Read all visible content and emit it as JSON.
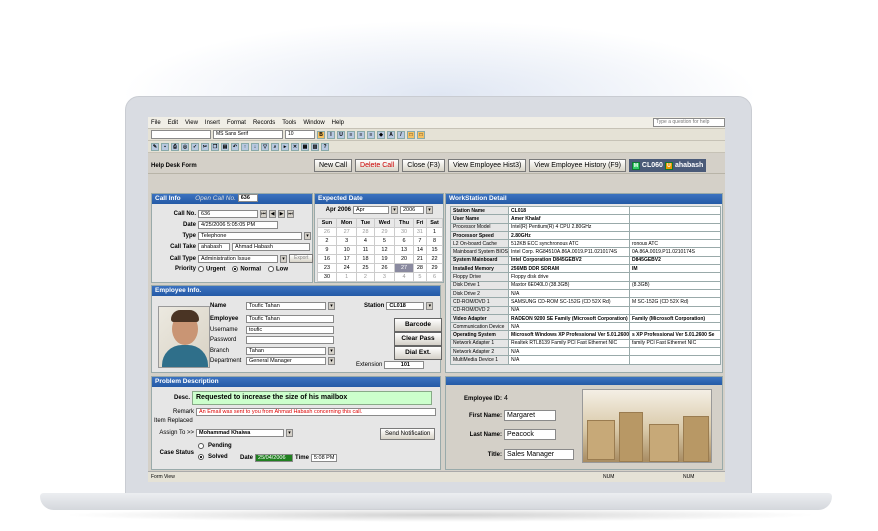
{
  "menu": [
    "File",
    "Edit",
    "View",
    "Insert",
    "Format",
    "Records",
    "Tools",
    "Window",
    "Help"
  ],
  "help_placeholder": "Type a question for help",
  "toolbar": {
    "font": "MS Sans Serif",
    "size": "10"
  },
  "form_title": "Help Desk Form",
  "buttons": {
    "new_call": "New Call",
    "delete_call": "Delete Call",
    "close": "Close (F3)",
    "view_hist": "View Employee Hist3)",
    "view_history": "View Employee History (F9)"
  },
  "emp_box": {
    "code": "CL060",
    "name": "ahabash"
  },
  "call_info": {
    "header": "Call Info",
    "open_call": "Open Call No.",
    "open_no": "636",
    "call_no_label": "Call No.",
    "call_no": "636",
    "date_label": "Date",
    "date": "4/25/2006 5:05:05 PM",
    "type_label": "Type",
    "type": "Telephone",
    "take_label": "Call Take",
    "take_user": "ahabash",
    "take_name": "Ahmad Habash",
    "calltype_label": "Call Type",
    "calltype": "Administration Issue",
    "export": "Export",
    "priority_label": "Priority",
    "priorities": [
      "Urgent",
      "Normal",
      "Low"
    ]
  },
  "expected": {
    "header": "Expected Date",
    "month_label": "Apr 2006",
    "month": "Apr",
    "year": "2006",
    "days": [
      "Sun",
      "Mon",
      "Tue",
      "Wed",
      "Thu",
      "Fri",
      "Sat"
    ],
    "weeks": [
      [
        "26",
        "27",
        "28",
        "29",
        "30",
        "31",
        "1"
      ],
      [
        "2",
        "3",
        "4",
        "5",
        "6",
        "7",
        "8"
      ],
      [
        "9",
        "10",
        "11",
        "12",
        "13",
        "14",
        "15"
      ],
      [
        "16",
        "17",
        "18",
        "19",
        "20",
        "21",
        "22"
      ],
      [
        "23",
        "24",
        "25",
        "26",
        "27",
        "28",
        "29"
      ],
      [
        "30",
        "1",
        "2",
        "3",
        "4",
        "5",
        "6"
      ]
    ]
  },
  "employee": {
    "header": "Employee Info.",
    "name_label": "Name",
    "name": "Toufic Tahan",
    "employee_label": "Employee",
    "employee": "Toufic Tahan",
    "username_label": "Username",
    "username": "toufic",
    "password_label": "Password",
    "branch_label": "Branch",
    "branch": "Tahan",
    "department_label": "Department",
    "department": "General Manager",
    "station_label": "Station",
    "station": "CL018",
    "barcode": "Barcode",
    "clear_pass": "Clear Pass",
    "dial_ext": "Dial Ext.",
    "extension_label": "Extension",
    "extension": "101"
  },
  "workstation": {
    "header": "WorkStation Detail",
    "rows": [
      [
        "Station Name",
        "CL018",
        ""
      ],
      [
        "User Name",
        "Amer Khalaf",
        ""
      ],
      [
        "Processor Model",
        "Intel(R) Pentium(R) 4 CPU 2.80GHz",
        ""
      ],
      [
        "Processor Speed",
        "2.80GHz",
        ""
      ],
      [
        "L2 On-board Cache",
        "512KB ECC synchronous ATC",
        "ronous ATC"
      ],
      [
        "Mainboard System BIOS",
        "Intel Corp. RG84510A.86A.0019.P11.0210174S",
        "0A.86A.0019.P11.0210174S"
      ],
      [
        "System Mainboard",
        "Intel Corporation D845GEBV2",
        "D845GEBV2"
      ],
      [
        "Installed Memory",
        "256MB DDR SDRAM",
        "IM"
      ],
      [
        "Floppy Drive",
        "Floppy disk drive",
        ""
      ],
      [
        "Disk Drive 1",
        "Maxtor 6E040L0 (38.3GB)",
        "(8.3GB)"
      ],
      [
        "Disk Drive 2",
        "N/A",
        ""
      ],
      [
        "CD-ROM/DVD 1",
        "SAMSUNG CD-ROM SC-152G (CD 52X Rd)",
        "M SC-152G (CD 52X Rd)"
      ],
      [
        "CD-ROM/DVD 2",
        "N/A",
        ""
      ],
      [
        "Video Adapter",
        "RADEON 9200 SE Family (Microsoft Corporation)",
        "Family (Microsoft Corporation)"
      ],
      [
        "Communication Device",
        "N/A",
        ""
      ],
      [
        "Operating System",
        "Microsoft Windows XP Professional Ver 5.01.2600",
        "s XP Professional Ver 5.01.2600 Se"
      ],
      [
        "Network Adapter 1",
        "Realtek RTL8139 Family PCI Fast Ethernet NIC",
        "family PCI Fast Ethernet NIC"
      ],
      [
        "Network Adapter 2",
        "N/A",
        ""
      ],
      [
        "MultiMedia Device 1",
        "N/A",
        ""
      ]
    ]
  },
  "problem": {
    "header": "Problem Description",
    "desc_label": "Desc.",
    "desc": "Requested to increase the size of his mailbox",
    "remark_label": "Remark",
    "remark": "An Email was sent to you from Ahmad Habash concerning this call.",
    "replaced_label": "Item Replaced",
    "assign_label": "Assign To >>",
    "assign": "Mohammad Khaiwa",
    "send": "Send Notification",
    "case_label": "Case Status",
    "pending": "Pending",
    "solved": "Solved",
    "date_label": "Date",
    "date": "25/04/2006",
    "time_label": "Time",
    "time": "5:08 PM"
  },
  "emp_card": {
    "id_label": "Employee ID:",
    "id": "4",
    "first_label": "First Name:",
    "first": "Margaret",
    "last_label": "Last Name:",
    "last": "Peacock",
    "title_label": "Title:",
    "title": "Sales Manager"
  },
  "statusbar": {
    "left": "Form View",
    "num1": "NUM",
    "num2": "NUM"
  }
}
